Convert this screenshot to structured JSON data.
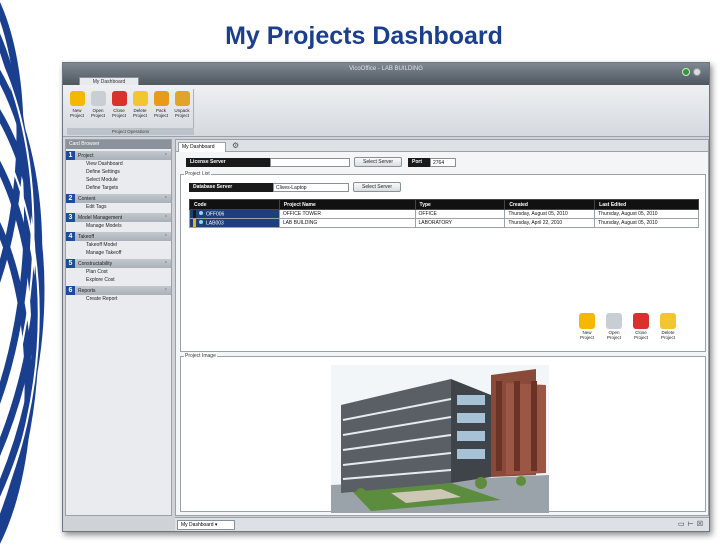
{
  "slide": {
    "title": "My Projects Dashboard"
  },
  "window": {
    "title": "VicoOffice - LAB BUILDING",
    "app_tab": "My Dashboard"
  },
  "ribbon": {
    "group_label": "Project Operations",
    "buttons": [
      {
        "label": "New Project",
        "color": "#f4b800"
      },
      {
        "label": "Open Project",
        "color": "#c9ced4"
      },
      {
        "label": "Close Project",
        "color": "#d9322c"
      },
      {
        "label": "Delete Project",
        "color": "#f2c531"
      },
      {
        "label": "Pack Project",
        "color": "#e89a1a"
      },
      {
        "label": "Unpack Project",
        "color": "#e0a528"
      }
    ]
  },
  "sidebar": {
    "header": "Card Browser",
    "sections": [
      {
        "num": "1",
        "title": "Project",
        "items": [
          "View Dashboard",
          "Define Settings",
          "Select Module",
          "Define Targets"
        ]
      },
      {
        "num": "2",
        "title": "Content",
        "items": [
          "Edit Tags"
        ]
      },
      {
        "num": "3",
        "title": "Model Management",
        "items": [
          "Manage Models"
        ]
      },
      {
        "num": "4",
        "title": "Takeoff",
        "items": [
          "Takeoff Model",
          "Manage Takeoff"
        ]
      },
      {
        "num": "5",
        "title": "Constructability",
        "items": [
          "Plan Cost",
          "Explore Cost"
        ]
      },
      {
        "num": "6",
        "title": "Reports",
        "items": [
          "Create Report"
        ]
      }
    ]
  },
  "main": {
    "tab": "My Dashboard",
    "license_label": "License Server",
    "license_value": "",
    "select_server": "Select Server",
    "port_label": "Port",
    "port_value": "2764",
    "project_list_label": "Project List",
    "db_label": "Database Server",
    "db_value": "Clives-Laptop",
    "columns": [
      "Code",
      "Project Name",
      "Type",
      "Created",
      "Last Edited"
    ],
    "rows": [
      {
        "code": "OFF006",
        "name": "OFFICE TOWER",
        "type": "OFFICE",
        "created": "Thursday, August 05, 2010",
        "edited": "Thursday, August 05, 2010"
      },
      {
        "code": "LAB003",
        "name": "LAB BUILDING",
        "type": "LABORATORY",
        "created": "Thursday, April 22, 2010",
        "edited": "Thursday, August 05, 2010"
      }
    ],
    "project_buttons": [
      {
        "label": "New Project",
        "color": "#f4b800"
      },
      {
        "label": "Open Project",
        "color": "#c9ced4"
      },
      {
        "label": "Close Project",
        "color": "#d9322c"
      },
      {
        "label": "Delete Project",
        "color": "#f2c531"
      }
    ],
    "project_image_label": "Project Image"
  },
  "statusbar": {
    "view": "My Dashboard"
  }
}
